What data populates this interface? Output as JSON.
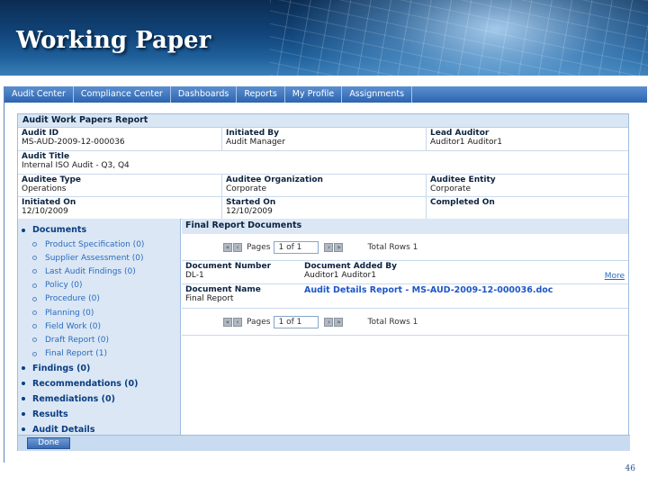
{
  "slide": {
    "title": "Working Paper",
    "page_number": "46"
  },
  "nav": [
    "Audit Center",
    "Compliance Center",
    "Dashboards",
    "Reports",
    "My Profile",
    "Assignments"
  ],
  "report": {
    "title": "Audit Work Papers Report",
    "audit_id": {
      "label": "Audit ID",
      "value": "MS-AUD-2009-12-000036"
    },
    "initiated_by": {
      "label": "Initiated By",
      "value": "Audit Manager"
    },
    "lead_auditor": {
      "label": "Lead Auditor",
      "value": "Auditor1 Auditor1"
    },
    "audit_title": {
      "label": "Audit Title",
      "value": "Internal ISO Audit - Q3, Q4"
    },
    "auditee_type": {
      "label": "Auditee Type",
      "value": "Operations"
    },
    "auditee_org": {
      "label": "Auditee Organization",
      "value": "Corporate"
    },
    "auditee_entity": {
      "label": "Auditee Entity",
      "value": "Corporate"
    },
    "initiated_on": {
      "label": "Initiated On",
      "value": "12/10/2009"
    },
    "started_on": {
      "label": "Started On",
      "value": "12/10/2009"
    },
    "completed_on": {
      "label": "Completed On",
      "value": ""
    }
  },
  "tree": {
    "documents": "Documents",
    "sub_items": [
      "Product Specification (0)",
      "Supplier Assessment (0)",
      "Last Audit Findings (0)",
      "Policy (0)",
      "Procedure (0)",
      "Planning (0)",
      "Field Work (0)",
      "Draft Report (0)",
      "Final Report (1)"
    ],
    "findings": "Findings (0)",
    "recommendations": "Recommendations (0)",
    "remediations": "Remediations (0)",
    "results": "Results",
    "audit_details": "Audit Details"
  },
  "docs": {
    "title": "Final Report Documents",
    "pager": {
      "pages_label": "Pages",
      "page_value": "1 of 1",
      "total_rows": "Total Rows 1"
    },
    "document_number": {
      "label": "Document Number",
      "value": "DL-1"
    },
    "document_added_by": {
      "label": "Document Added By",
      "value": "Auditor1 Auditor1"
    },
    "more_link": "More",
    "document_name": {
      "label": "Document Name",
      "value": "Final Report"
    },
    "document_link": "Audit Details Report - MS-AUD-2009-12-000036.doc"
  },
  "done_label": "Done",
  "colors": {
    "nav_bg": "#2d64b0",
    "panel_header": "#d9e6f4",
    "link": "#1e56c8"
  }
}
